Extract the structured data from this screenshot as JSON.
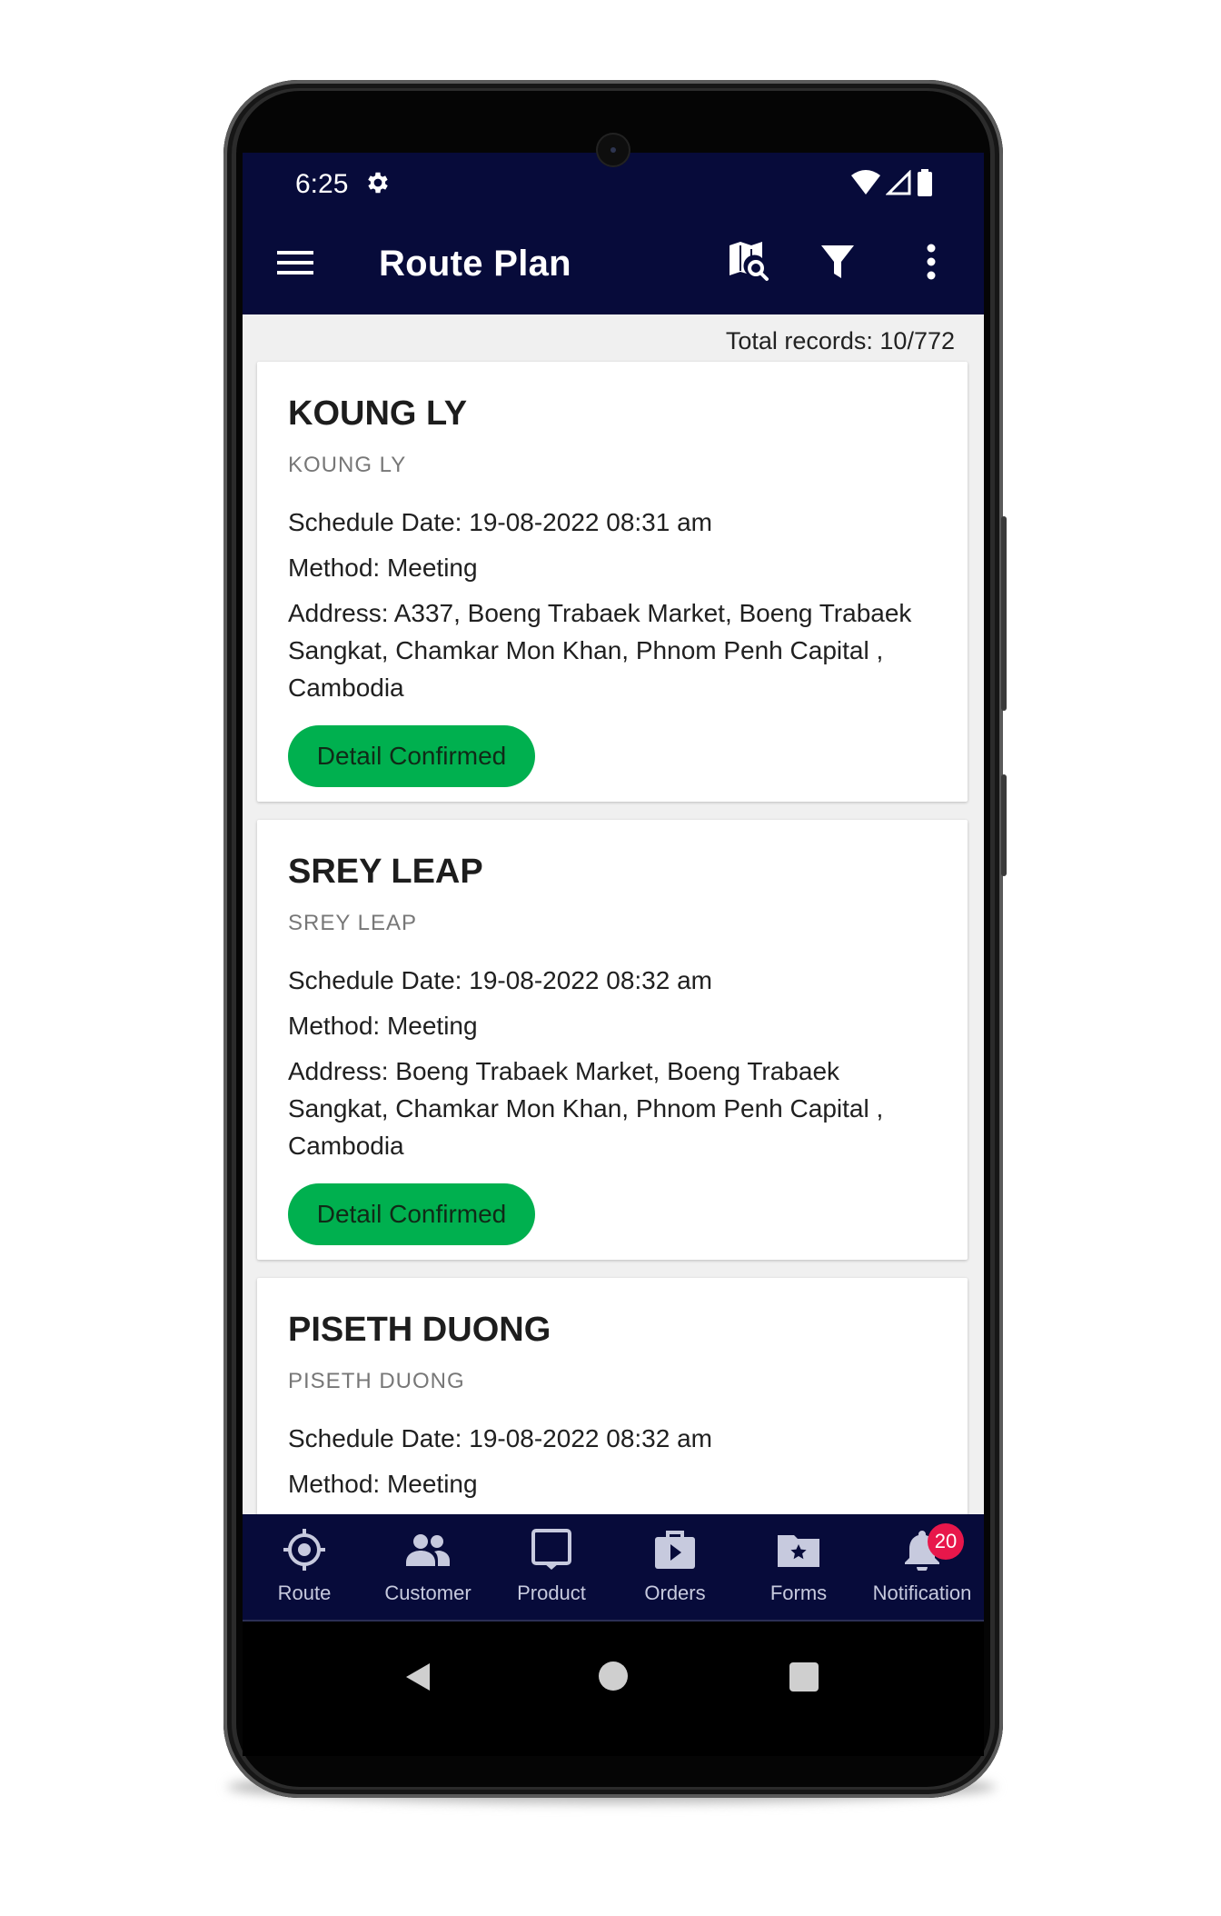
{
  "status_bar": {
    "time": "6:25"
  },
  "app_bar": {
    "title": "Route Plan"
  },
  "list": {
    "total_records": "Total records: 10/772",
    "cards": [
      {
        "title": "KOUNG LY",
        "subtitle": "KOUNG LY",
        "schedule": "Schedule Date: 19-08-2022 08:31 am",
        "method": "Method: Meeting",
        "address": "Address: A337, Boeng Trabaek Market, Boeng Trabaek Sangkat, Chamkar Mon Khan, Phnom Penh Capital , Cambodia",
        "status": "Detail Confirmed"
      },
      {
        "title": "SREY LEAP",
        "subtitle": "SREY LEAP",
        "schedule": "Schedule Date: 19-08-2022 08:32 am",
        "method": "Method: Meeting",
        "address": "Address: Boeng Trabaek Market, Boeng Trabaek Sangkat, Chamkar Mon Khan, Phnom Penh Capital , Cambodia",
        "status": "Detail Confirmed"
      },
      {
        "title": "PISETH DUONG",
        "subtitle": "PISETH DUONG",
        "schedule": "Schedule Date: 19-08-2022 08:32 am",
        "method": "Method: Meeting"
      }
    ]
  },
  "bottom_nav": {
    "items": [
      {
        "label": "Route",
        "icon": "route-icon"
      },
      {
        "label": "Customer",
        "icon": "customer-icon"
      },
      {
        "label": "Product",
        "icon": "product-icon"
      },
      {
        "label": "Orders",
        "icon": "orders-icon"
      },
      {
        "label": "Forms",
        "icon": "forms-icon"
      },
      {
        "label": "Notification",
        "icon": "bell-icon",
        "badge": "20"
      }
    ]
  },
  "colors": {
    "app_bar": "#070b3a",
    "status_button": "#00b04f",
    "badge": "#e8174b"
  }
}
